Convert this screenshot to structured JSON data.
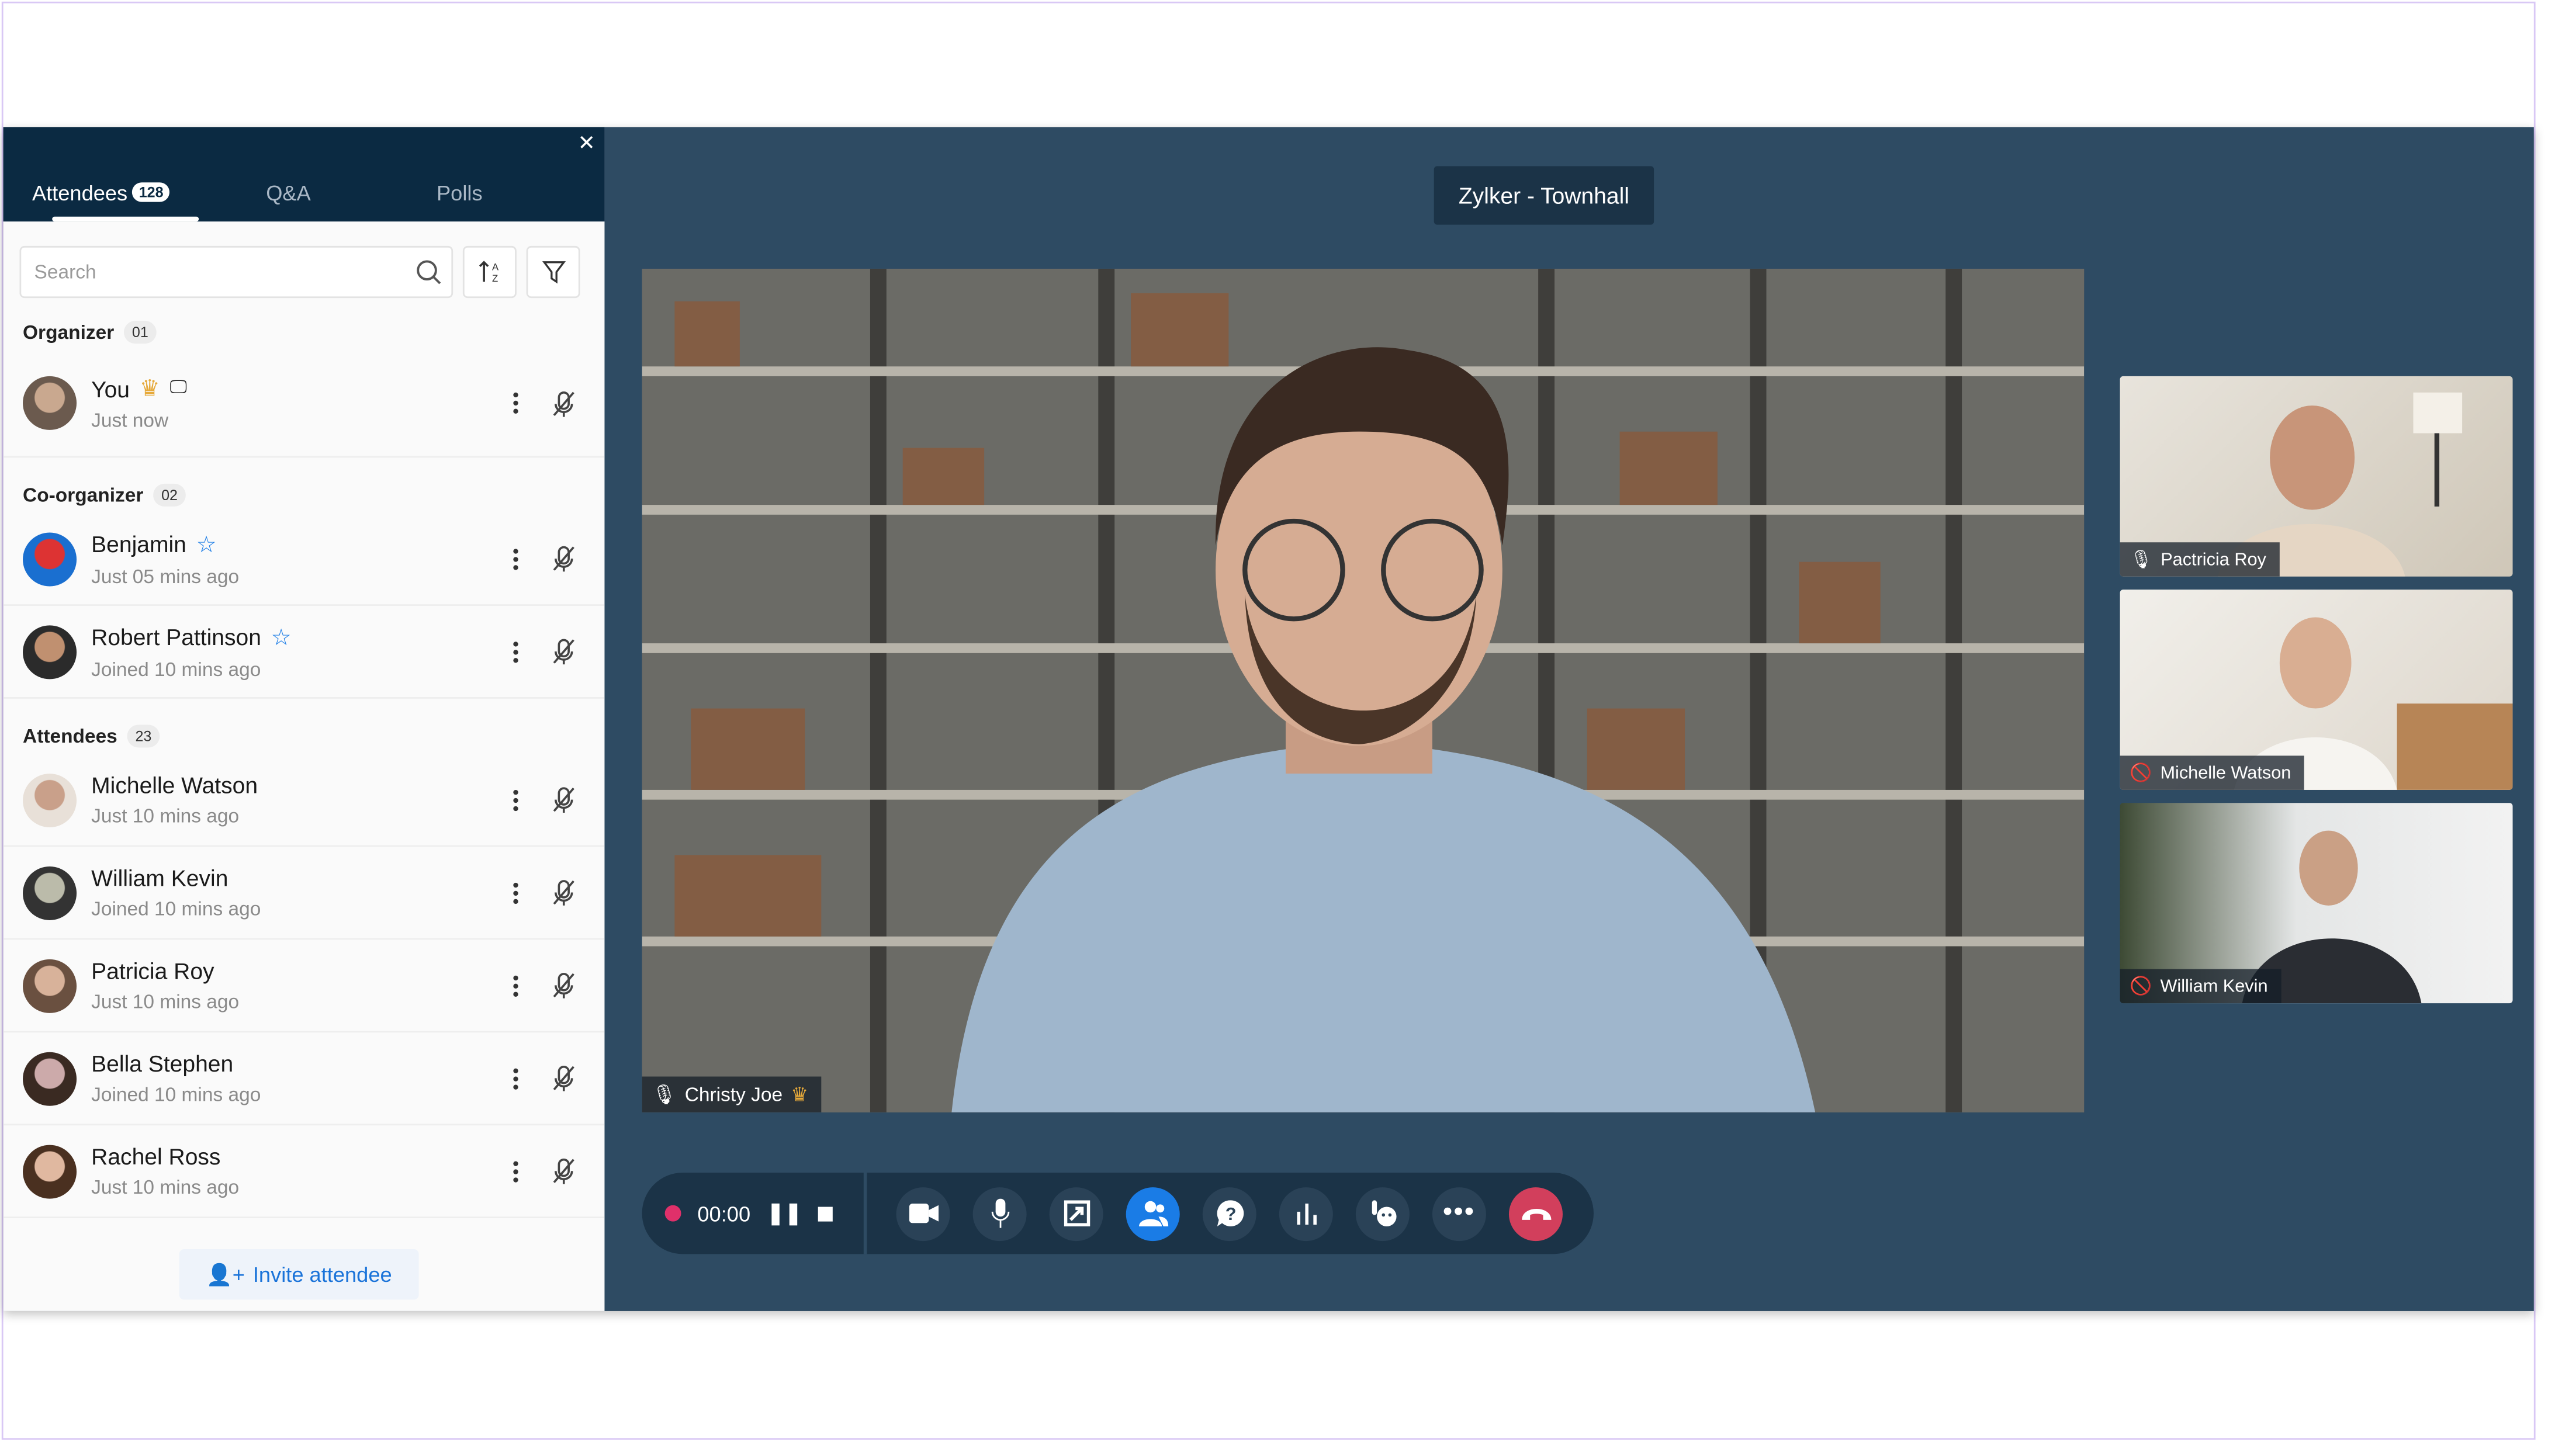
{
  "sidebar": {
    "tabs": [
      {
        "label": "Attendees",
        "badge": "128"
      },
      {
        "label": "Q&A"
      },
      {
        "label": "Polls"
      }
    ],
    "search_placeholder": "Search",
    "sections": [
      {
        "title": "Organizer",
        "count": "01",
        "people": [
          {
            "name": "You",
            "status": "Just now"
          }
        ]
      },
      {
        "title": "Co-organizer",
        "count": "02",
        "people": [
          {
            "name": "Benjamin",
            "status": "Just 05 mins ago"
          },
          {
            "name": "Robert Pattinson",
            "status": "Joined 10 mins ago"
          }
        ]
      },
      {
        "title": "Attendees",
        "count": "23",
        "people": [
          {
            "name": "Michelle Watson",
            "status": "Just 10 mins ago"
          },
          {
            "name": "William Kevin",
            "status": "Joined 10 mins ago"
          },
          {
            "name": "Patricia Roy",
            "status": "Just 10 mins ago"
          },
          {
            "name": "Bella Stephen",
            "status": "Joined 10 mins ago"
          },
          {
            "name": "Rachel Ross",
            "status": "Just 10 mins ago"
          }
        ]
      }
    ],
    "invite_label": "Invite attendee"
  },
  "meeting": {
    "title": "Zylker - Townhall",
    "speaker": "Christy Joe",
    "thumbnails": [
      {
        "name": "Pactricia Roy"
      },
      {
        "name": "Michelle Watson"
      },
      {
        "name": "William Kevin"
      }
    ],
    "timer": "00:00"
  },
  "colors": {
    "navy": "#0b2a42",
    "stage": "#2e4b63",
    "accent": "#1a7ce6",
    "end": "#d23f5c",
    "record": "#e0306a"
  }
}
